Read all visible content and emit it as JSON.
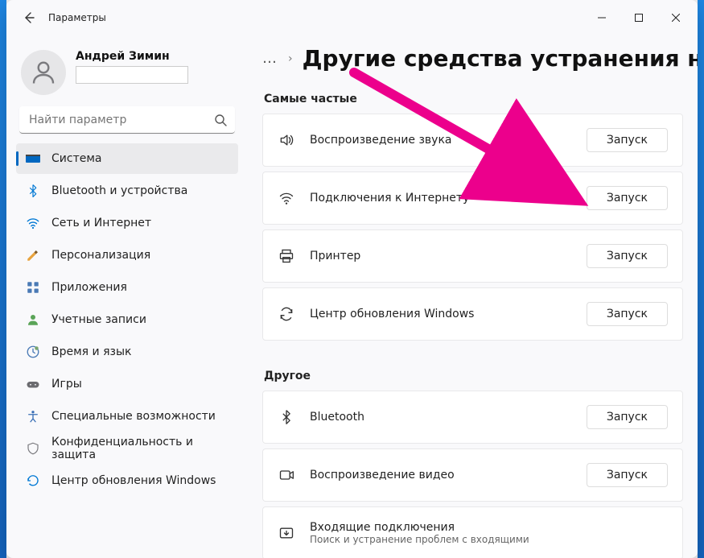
{
  "window": {
    "title": "Параметры"
  },
  "profile": {
    "name": "Андрей Зимин"
  },
  "search": {
    "placeholder": "Найти параметр"
  },
  "nav": [
    {
      "label": "Система",
      "icon": "system",
      "active": true
    },
    {
      "label": "Bluetooth и устройства",
      "icon": "bluetooth",
      "active": false
    },
    {
      "label": "Сеть и Интернет",
      "icon": "network",
      "active": false
    },
    {
      "label": "Персонализация",
      "icon": "personalization",
      "active": false
    },
    {
      "label": "Приложения",
      "icon": "apps",
      "active": false
    },
    {
      "label": "Учетные записи",
      "icon": "accounts",
      "active": false
    },
    {
      "label": "Время и язык",
      "icon": "time",
      "active": false
    },
    {
      "label": "Игры",
      "icon": "gaming",
      "active": false
    },
    {
      "label": "Специальные возможности",
      "icon": "accessibility",
      "active": false
    },
    {
      "label": "Конфиденциальность и защита",
      "icon": "privacy",
      "active": false
    },
    {
      "label": "Центр обновления Windows",
      "icon": "update",
      "active": false
    }
  ],
  "breadcrumb": {
    "dots": "…",
    "chevron": "›",
    "title": "Другие средства устранения неполадок"
  },
  "sections": {
    "frequent": {
      "header": "Самые частые",
      "items": [
        {
          "icon": "audio",
          "title": "Воспроизведение звука",
          "button": "Запуск"
        },
        {
          "icon": "wifi",
          "title": "Подключения к Интернету",
          "button": "Запуск"
        },
        {
          "icon": "printer",
          "title": "Принтер",
          "button": "Запуск"
        },
        {
          "icon": "sync",
          "title": "Центр обновления Windows",
          "button": "Запуск"
        }
      ]
    },
    "other": {
      "header": "Другое",
      "items": [
        {
          "icon": "bluetooth",
          "title": "Bluetooth",
          "button": "Запуск"
        },
        {
          "icon": "video",
          "title": "Воспроизведение видео",
          "button": "Запуск"
        },
        {
          "icon": "incoming",
          "title": "Входящие подключения",
          "subtitle": "Поиск и устранение проблем с входящими",
          "button": ""
        }
      ]
    }
  },
  "colors": {
    "accent": "#0067c0",
    "arrow": "#ec008c"
  }
}
